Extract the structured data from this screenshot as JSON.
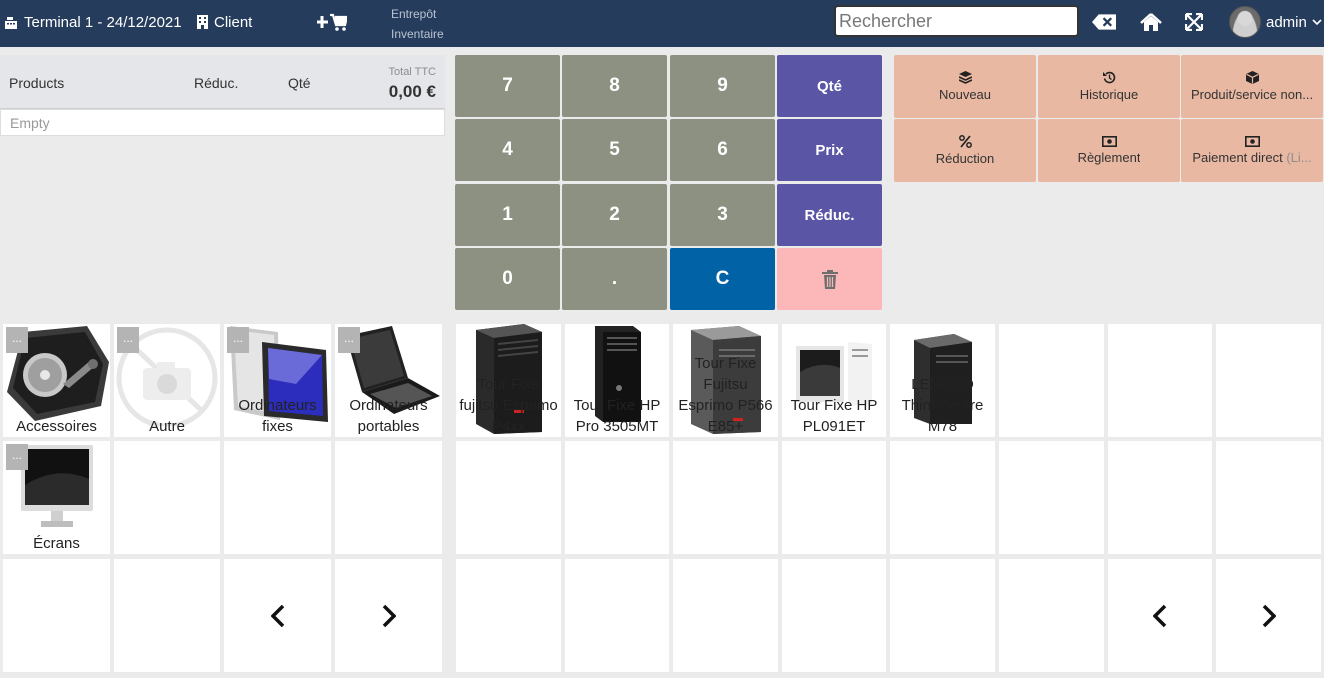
{
  "topbar": {
    "terminal": "Terminal 1 - 24/12/2021",
    "client": "Client",
    "links": [
      "Entrepôt",
      "Inventaire"
    ],
    "search_placeholder": "Rechercher",
    "user": "admin"
  },
  "ticket": {
    "col_products": "Products",
    "col_reduc": "Réduc.",
    "col_qte": "Qté",
    "total_label": "Total TTC",
    "total_value": "0,00 €",
    "empty": "Empty"
  },
  "keypad": {
    "k7": "7",
    "k8": "8",
    "k9": "9",
    "qte": "Qté",
    "k4": "4",
    "k5": "5",
    "k6": "6",
    "prix": "Prix",
    "k1": "1",
    "k2": "2",
    "k3": "3",
    "reduc": "Réduc.",
    "k0": "0",
    "dot": ".",
    "clear": "C"
  },
  "actions": {
    "nouveau": "Nouveau",
    "historique": "Historique",
    "produit": "Produit/service non...",
    "reduction": "Réduction",
    "reglement": "Règlement",
    "paiement": "Paiement direct",
    "paiement_suffix": "(Li..."
  },
  "categories": {
    "more": "...",
    "accessoires": "Accessoires",
    "autre": "Autre",
    "fixes": "Ordinateurs fixes",
    "portables": "Ordinateurs portables",
    "ecrans": "Écrans"
  },
  "products": {
    "p1": "Tour Fixe fujitsu Esprimo P4xx",
    "p2": "Tour Fixe HP Pro 3505MT",
    "p3": "Tour Fixe Fujitsu Esprimo P566 E85+",
    "p4": "Tour Fixe HP PL091ET",
    "p5": "LENOVO ThinkCentre M78"
  }
}
